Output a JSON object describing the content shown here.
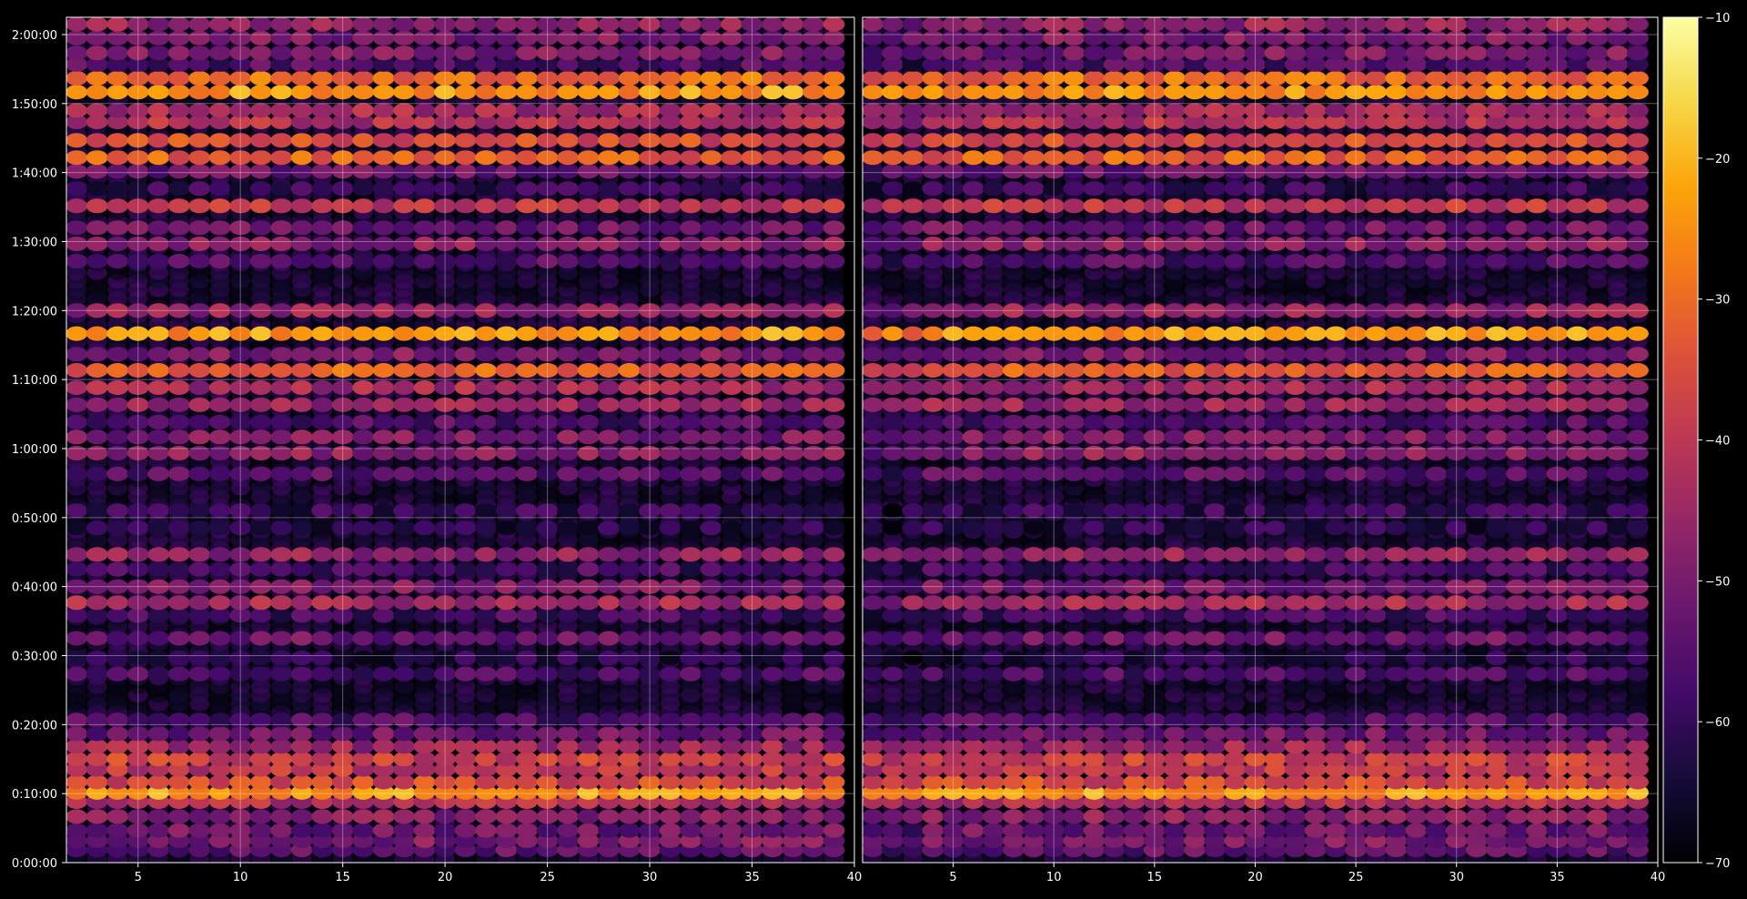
{
  "chart_data": {
    "type": "heatmap",
    "title": "",
    "xlabel": "",
    "ylabel": "",
    "colormap": "inferno",
    "background": "#000000",
    "grid": true,
    "panels": [
      {
        "name": "left",
        "xlim": [
          1.5,
          40
        ],
        "xticks": [
          5,
          10,
          15,
          20,
          25,
          30,
          35,
          40
        ]
      },
      {
        "name": "right",
        "xlim": [
          0.5,
          40
        ],
        "xticks": [
          5,
          10,
          15,
          20,
          25,
          30,
          35,
          40
        ]
      }
    ],
    "x_categories": [
      1,
      2,
      3,
      4,
      5,
      6,
      7,
      8,
      9,
      10,
      11,
      12,
      13,
      14,
      15,
      16,
      17,
      18,
      19,
      20,
      21,
      22,
      23,
      24,
      25,
      26,
      27,
      28,
      29,
      30,
      31,
      32,
      33,
      34,
      35,
      36,
      37,
      38,
      39
    ],
    "ylim_seconds": [
      0,
      7350
    ],
    "yticks": [
      "0:00:00",
      "0:10:00",
      "0:20:00",
      "0:30:00",
      "0:40:00",
      "0:50:00",
      "1:00:00",
      "1:10:00",
      "1:20:00",
      "1:30:00",
      "1:40:00",
      "1:50:00",
      "2:00:00"
    ],
    "ytick_seconds": [
      0,
      600,
      1200,
      1800,
      2400,
      3000,
      3600,
      4200,
      4800,
      5400,
      6000,
      6600,
      7200
    ],
    "row_levels": [
      {
        "t": 110,
        "level": -54
      },
      {
        "t": 190,
        "level": -50
      },
      {
        "t": 280,
        "level": -52
      },
      {
        "t": 400,
        "level": -48
      },
      {
        "t": 530,
        "level": -42
      },
      {
        "t": 610,
        "level": -24
      },
      {
        "t": 700,
        "level": -36
      },
      {
        "t": 810,
        "level": -40
      },
      {
        "t": 900,
        "level": -38
      },
      {
        "t": 1010,
        "level": -45
      },
      {
        "t": 1120,
        "level": -52
      },
      {
        "t": 1240,
        "level": -56
      },
      {
        "t": 1640,
        "level": -56
      },
      {
        "t": 1780,
        "level": -62
      },
      {
        "t": 1950,
        "level": -52
      },
      {
        "t": 2150,
        "level": -58
      },
      {
        "t": 2260,
        "level": -44
      },
      {
        "t": 2400,
        "level": -50
      },
      {
        "t": 2550,
        "level": -58
      },
      {
        "t": 2680,
        "level": -47
      },
      {
        "t": 2910,
        "level": -62
      },
      {
        "t": 3060,
        "level": -60
      },
      {
        "t": 3380,
        "level": -55
      },
      {
        "t": 3560,
        "level": -48
      },
      {
        "t": 3700,
        "level": -50
      },
      {
        "t": 3830,
        "level": -56
      },
      {
        "t": 3980,
        "level": -46
      },
      {
        "t": 4130,
        "level": -44
      },
      {
        "t": 4280,
        "level": -32
      },
      {
        "t": 4420,
        "level": -50
      },
      {
        "t": 4600,
        "level": -24
      },
      {
        "t": 4800,
        "level": -46
      },
      {
        "t": 5230,
        "level": -56
      },
      {
        "t": 5380,
        "level": -48
      },
      {
        "t": 5520,
        "level": -52
      },
      {
        "t": 5710,
        "level": -40
      },
      {
        "t": 5860,
        "level": -60
      },
      {
        "t": 6010,
        "level": -52
      },
      {
        "t": 6130,
        "level": -32
      },
      {
        "t": 6280,
        "level": -36
      },
      {
        "t": 6440,
        "level": -42
      },
      {
        "t": 6540,
        "level": -44
      },
      {
        "t": 6700,
        "level": -24
      },
      {
        "t": 6820,
        "level": -30
      },
      {
        "t": 6940,
        "level": -56
      },
      {
        "t": 7040,
        "level": -50
      },
      {
        "t": 7170,
        "level": -50
      },
      {
        "t": 7290,
        "level": -46
      }
    ],
    "colorbar": {
      "range": [
        -70,
        -10
      ],
      "ticks": [
        -10,
        -20,
        -30,
        -40,
        -50,
        -60,
        -70
      ],
      "tick_labels": [
        "−10",
        "−20",
        "−30",
        "−40",
        "−50",
        "−60",
        "−70"
      ]
    }
  }
}
